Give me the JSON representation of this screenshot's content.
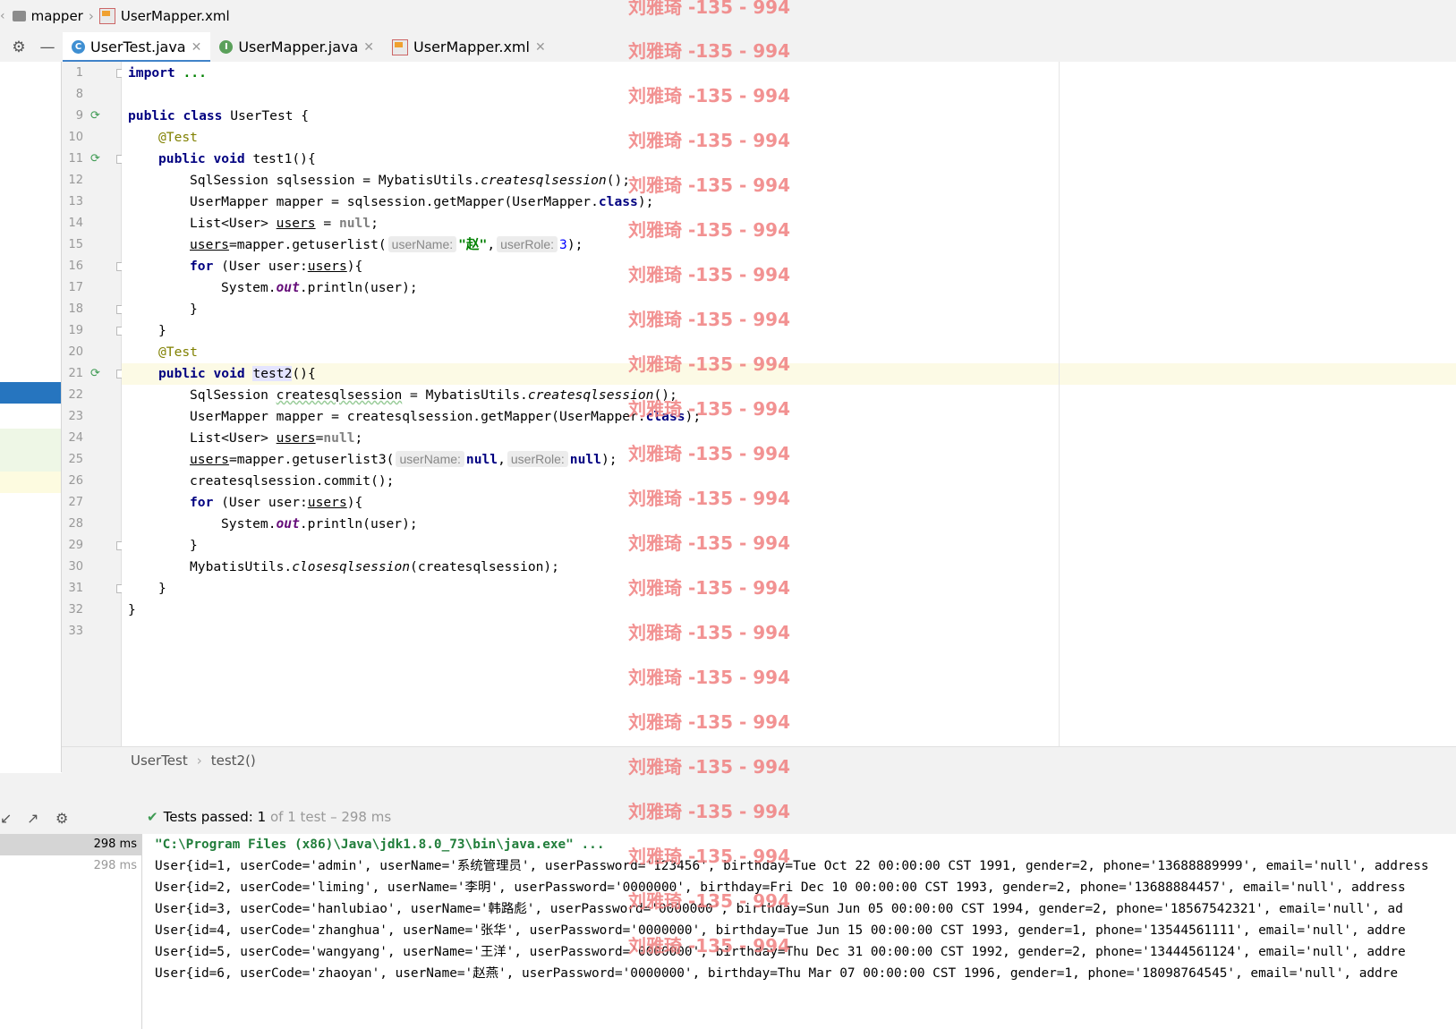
{
  "breadcrumb": {
    "folder": "mapper",
    "file": "UserMapper.xml"
  },
  "tabs": [
    {
      "label": "UserTest.java",
      "icon": "C",
      "active": true
    },
    {
      "label": "UserMapper.java",
      "icon": "I",
      "active": false
    },
    {
      "label": "UserMapper.xml",
      "icon": "xml",
      "active": false
    }
  ],
  "gutter": {
    "line_numbers": [
      "1",
      "8",
      "9",
      "10",
      "11",
      "12",
      "13",
      "14",
      "15",
      "16",
      "17",
      "18",
      "19",
      "20",
      "21",
      "22",
      "23",
      "24",
      "25",
      "26",
      "27",
      "28",
      "29",
      "30",
      "31",
      "32",
      "33"
    ]
  },
  "code": {
    "l1_kw": "import",
    "l1_rest": " ...",
    "l9_a": "public class",
    "l9_b": " UserTest {",
    "l10": "@Test",
    "l11_a": "public void",
    "l11_b": " test1(){",
    "l12_a": "SqlSession sqlsession = MybatisUtils.",
    "l12_b": "createsqlsession",
    "l12_c": "();",
    "l13_a": "UserMapper mapper = sqlsession.getMapper(UserMapper.",
    "l13_b": "class",
    "l13_c": ");",
    "l14_a": "List<User> ",
    "l14_b": "users",
    "l14_c": " = ",
    "l14_d": "null",
    "l14_e": ";",
    "l15_a": "users",
    "l15_b": "=mapper.getuserlist(",
    "l15_hint1": "userName:",
    "l15_str": "\"赵\"",
    "l15_comma": ",",
    "l15_hint2": "userRole:",
    "l15_num": "3",
    "l15_end": ");",
    "l16_a": "for",
    "l16_b": " (User user:",
    "l16_c": "users",
    "l16_d": "){",
    "l17_a": "System.",
    "l17_b": "out",
    "l17_c": ".println(user);",
    "l18": "}",
    "l19": "}",
    "l20": "@Test",
    "l21_a": "public void",
    "l21_sp": " ",
    "l21_b": "test2",
    "l21_c": "(){",
    "l22_a": "SqlSession ",
    "l22_b": "createsqlsession",
    "l22_c": " = MybatisUtils.",
    "l22_d": "createsqlsession",
    "l22_e": "();",
    "l23_a": "UserMapper mapper = createsqlsession.getMapper(UserMapper.",
    "l23_b": "class",
    "l23_c": ");",
    "l24_a": "List<User> ",
    "l24_b": "users",
    "l24_c": "=",
    "l24_d": "null",
    "l24_e": ";",
    "l25_a": "users",
    "l25_b": "=mapper.getuserlist3(",
    "l25_hint1": "userName:",
    "l25_null1": "null",
    "l25_comma": ",",
    "l25_hint2": "userRole:",
    "l25_null2": "null",
    "l25_end": ");",
    "l26": "createsqlsession.commit();",
    "l27_a": "for",
    "l27_b": " (User user:",
    "l27_c": "users",
    "l27_d": "){",
    "l28_a": "System.",
    "l28_b": "out",
    "l28_c": ".println(user);",
    "l29": "}",
    "l30_a": "MybatisUtils.",
    "l30_b": "closesqlsession",
    "l30_c": "(createsqlsession);",
    "l31": "}",
    "l32": "}"
  },
  "editor_breadcrumb": {
    "class": "UserTest",
    "method": "test2()"
  },
  "run": {
    "status_prefix": "Tests passed:",
    "passed": "1",
    "status_suffix": "of 1 test – 298 ms",
    "tree": [
      "298 ms",
      "298 ms"
    ],
    "console": [
      "\"C:\\Program Files (x86)\\Java\\jdk1.8.0_73\\bin\\java.exe\" ...",
      "User{id=1, userCode='admin', userName='系统管理员', userPassword='123456', birthday=Tue Oct 22 00:00:00 CST 1991, gender=2, phone='13688889999', email='null', address",
      "User{id=2, userCode='liming', userName='李明', userPassword='0000000', birthday=Fri Dec 10 00:00:00 CST 1993, gender=2, phone='13688884457', email='null', address",
      "User{id=3, userCode='hanlubiao', userName='韩路彪', userPassword='0000000', birthday=Sun Jun 05 00:00:00 CST 1994, gender=2, phone='18567542321', email='null', ad",
      "User{id=4, userCode='zhanghua', userName='张华', userPassword='0000000', birthday=Tue Jun 15 00:00:00 CST 1993, gender=1, phone='13544561111', email='null', addre",
      "User{id=5, userCode='wangyang', userName='王洋', userPassword='0000000', birthday=Thu Dec 31 00:00:00 CST 1992, gender=2, phone='13444561124', email='null', addre",
      "User{id=6, userCode='zhaoyan', userName='赵燕', userPassword='0000000', birthday=Thu Mar 07 00:00:00 CST 1996, gender=1, phone='18098764545', email='null', addre"
    ]
  },
  "watermark": "刘雅琦 -135 - 994",
  "colors": {
    "accent": "#4083c9",
    "keyword": "#000080",
    "annotation": "#808000",
    "string": "#008000",
    "number": "#0000ff",
    "watermark": "#f08080",
    "run_green": "#3d9a52"
  }
}
